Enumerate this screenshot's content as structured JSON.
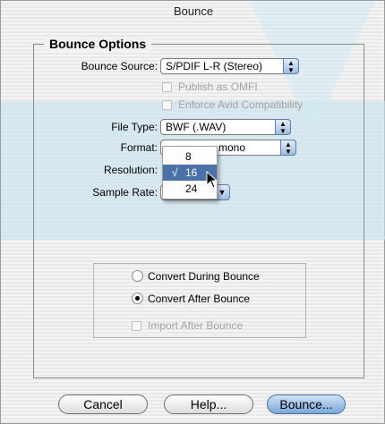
{
  "window": {
    "title": "Bounce"
  },
  "group": {
    "title": "Bounce Options"
  },
  "bounce_source": {
    "label": "Bounce Source:",
    "value": "S/PDIF L-R (Stereo)"
  },
  "checkboxes": {
    "publish_omfi": {
      "label": "Publish as OMFI",
      "checked": false,
      "enabled": false
    },
    "enforce_avid": {
      "label": "Enforce Avid Compatibility",
      "checked": false,
      "enabled": false
    }
  },
  "file_type": {
    "label": "File Type:",
    "value": "BWF (.WAV)"
  },
  "format": {
    "label": "Format:",
    "value": "mono"
  },
  "resolution": {
    "label": "Resolution:",
    "menu_options": [
      "8",
      "16",
      "24"
    ],
    "selected": "16",
    "check_mark": "√"
  },
  "sample_rate": {
    "label": "Sample Rate:"
  },
  "conversion": {
    "options": [
      {
        "label": "Convert During Bounce",
        "selected": false
      },
      {
        "label": "Convert After Bounce",
        "selected": true
      }
    ],
    "import_after": {
      "label": "Import After Bounce",
      "checked": false,
      "enabled": false
    }
  },
  "buttons": {
    "cancel": "Cancel",
    "help": "Help...",
    "bounce": "Bounce..."
  },
  "colors": {
    "accent_blue": "#4a72a8",
    "default_button": "#7aa7d8",
    "disabled_text": "#a2a2a2"
  }
}
